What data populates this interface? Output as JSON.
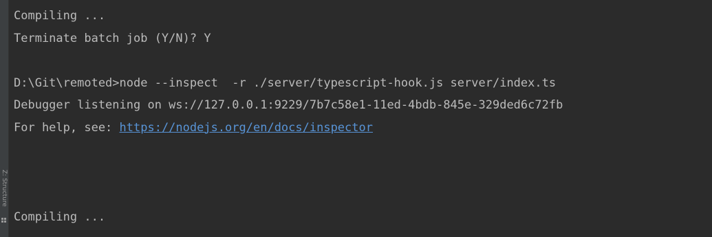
{
  "sidebar": {
    "structure_label": "Z: Structure",
    "structure_icon": "structure-icon"
  },
  "console": {
    "lines": [
      {
        "text": "Compiling ..."
      },
      {
        "text": "Terminate batch job (Y/N)? Y"
      },
      {
        "text": ""
      },
      {
        "text": "D:\\Git\\remoted>node --inspect  -r ./server/typescript-hook.js server/index.ts"
      },
      {
        "text": "Debugger listening on ws://127.0.0.1:9229/7b7c58e1-11ed-4bdb-845e-329ded6c72fb"
      },
      {
        "prefix": "For help, see: ",
        "link": "https://nodejs.org/en/docs/inspector"
      },
      {
        "text": ""
      },
      {
        "text": ""
      },
      {
        "text": ""
      },
      {
        "text": "Compiling ..."
      }
    ]
  },
  "colors": {
    "background": "#2b2b2b",
    "text": "#bbbbbb",
    "link": "#5894d7"
  }
}
